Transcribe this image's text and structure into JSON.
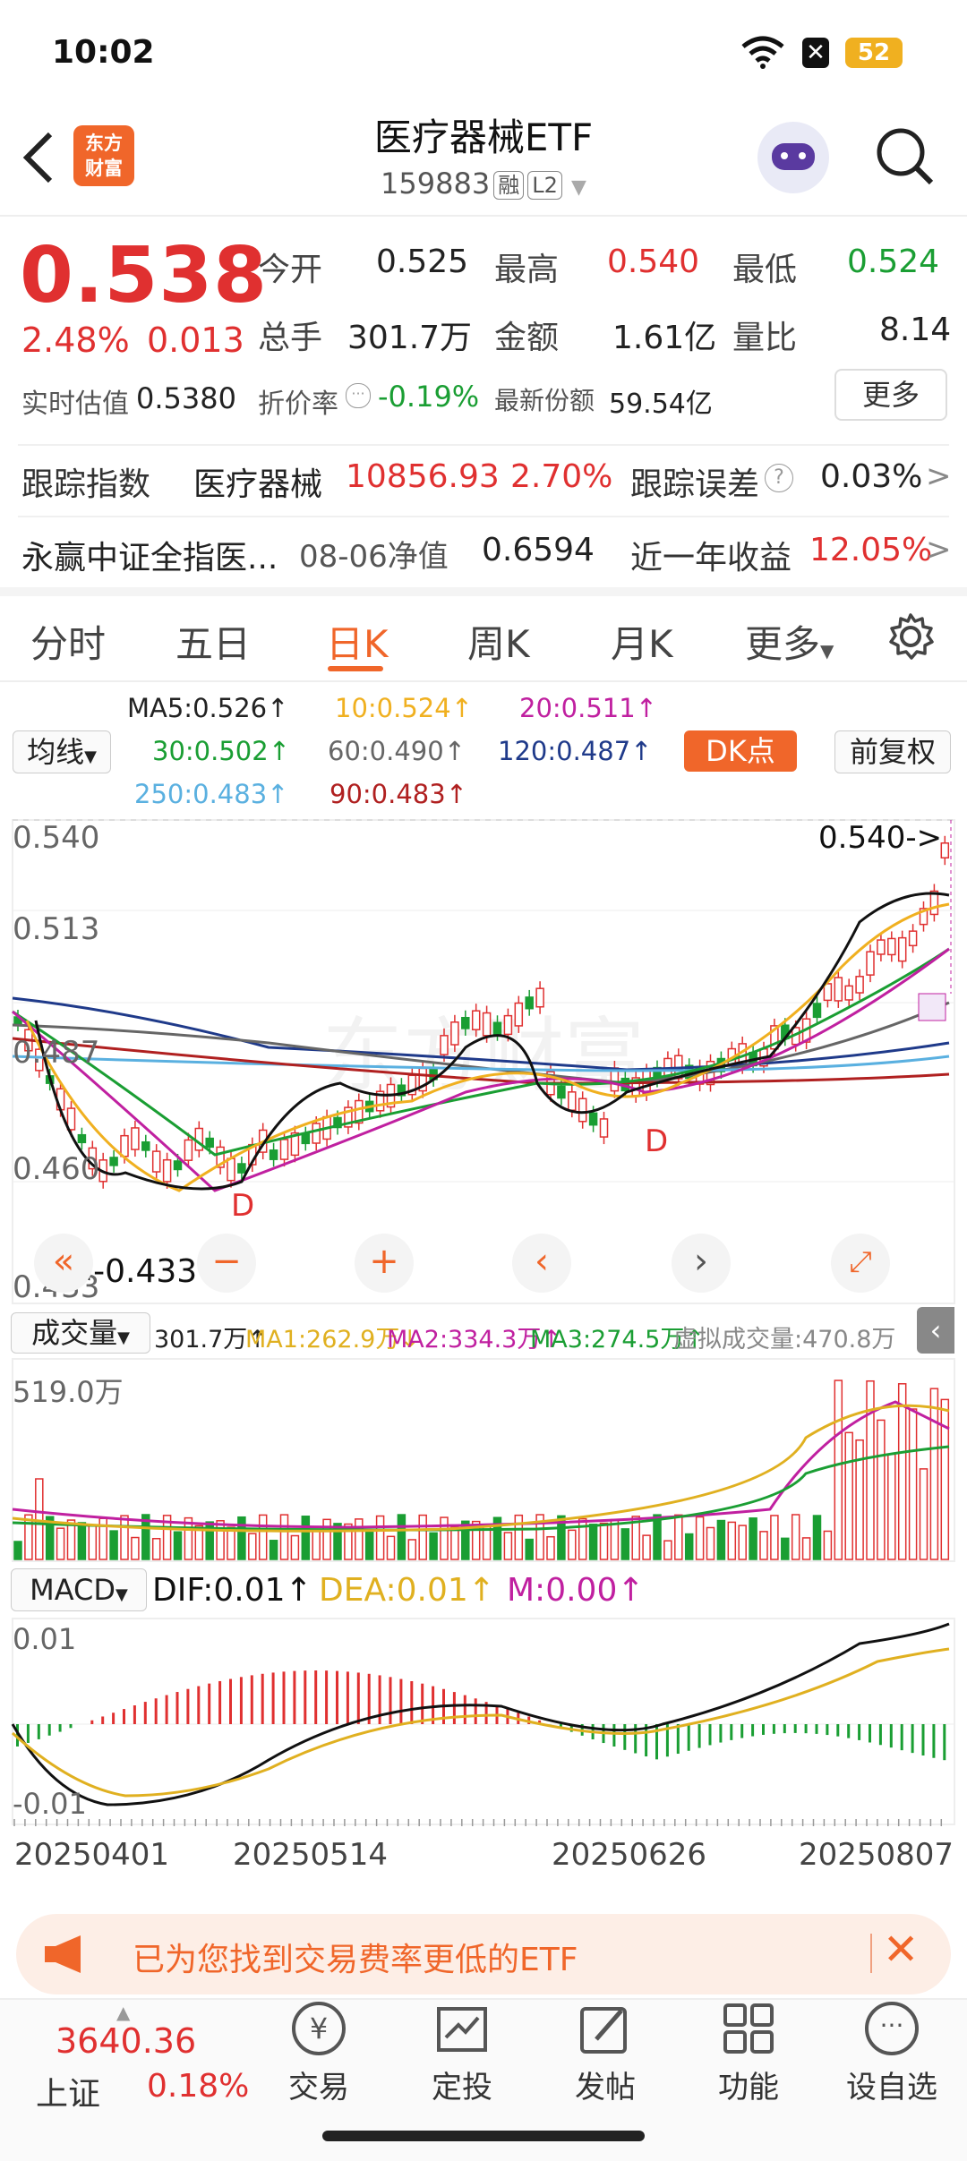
{
  "status_bar": {
    "time": "10:02",
    "battery": "52"
  },
  "header": {
    "title": "医疗器械ETF",
    "code": "159883",
    "tag_rong": "融",
    "tag_level": "L2",
    "brand_logo": "东方\n财富"
  },
  "quote": {
    "price": "0.538",
    "change_pct": "2.48%",
    "change_amt": "0.013",
    "open_label": "今开",
    "open": "0.525",
    "high_label": "最高",
    "high": "0.540",
    "low_label": "最低",
    "low": "0.524",
    "vol_label": "总手",
    "vol": "301.7万",
    "amount_label": "金额",
    "amount": "1.61亿",
    "ratio_label": "量比",
    "ratio": "8.14",
    "iopv_label": "实时估值",
    "iopv": "0.5380",
    "premium_label": "折价率",
    "premium": "-0.19%",
    "shares_label": "最新份额",
    "shares": "59.54亿",
    "more": "更多"
  },
  "tracking": {
    "label": "跟踪指数",
    "index_name": "医疗器械",
    "index_value": "10856.93",
    "index_pct": "2.70%",
    "error_label": "跟踪误差",
    "error": "0.03%"
  },
  "fund": {
    "name": "永赢中证全指医...",
    "nav_label": "08-06净值",
    "nav": "0.6594",
    "yr_label": "近一年收益",
    "yr": "12.05%"
  },
  "tabs": [
    "分时",
    "五日",
    "日K",
    "周K",
    "月K",
    "更多"
  ],
  "active_tab": "日K",
  "ma_legend": {
    "selector": "均线",
    "ma5": "MA5:0.526↑",
    "ma10": "10:0.524↑",
    "ma20": "20:0.511↑",
    "ma30": "30:0.502↑",
    "ma60": "60:0.490↑",
    "ma120": "120:0.487↑",
    "ma250": "250:0.483↑",
    "ma90": "90:0.483↑",
    "dk": "DK点",
    "fq": "前复权"
  },
  "kline_axis": {
    "y1": "0.540",
    "y2": "0.513",
    "y3": "0.487",
    "y4": "0.460",
    "y5": "0.433",
    "high_mark": "0.540->",
    "low_mark": "<-0.433",
    "d_marker": "D"
  },
  "volume": {
    "selector": "成交量",
    "vol": "301.7万↑",
    "ma1": "MA1:262.9万↓",
    "ma2": "MA2:334.3万↑",
    "ma3": "MA3:274.5万↑",
    "virtual": "虚拟成交量:470.8万",
    "ymax": "519.0万"
  },
  "macd": {
    "selector": "MACD",
    "dif": "DIF:0.01↑",
    "dea": "DEA:0.01↑",
    "m": "M:0.00↑",
    "ytop": "0.01",
    "ybottom": "-0.01"
  },
  "dates": [
    "20250401",
    "20250514",
    "20250626",
    "20250807"
  ],
  "promo": {
    "text": "已为您找到交易费率更低的ETF"
  },
  "bottom_nav": {
    "index_value": "3640.36",
    "index_name": "上证",
    "index_pct": "0.18%",
    "items": [
      "交易",
      "定投",
      "发帖",
      "功能",
      "设自选"
    ]
  },
  "colors": {
    "up": "#e03030",
    "down": "#1a9e33",
    "accent": "#f0662a"
  }
}
